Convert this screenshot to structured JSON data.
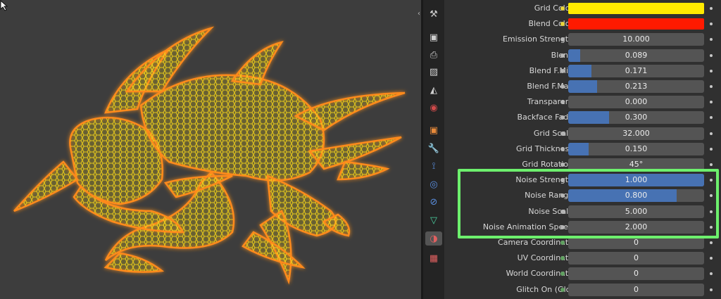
{
  "colors": {
    "grid_color": "#ffea00",
    "blend_color": "#ff1a00",
    "accent_fill": "#4772b3",
    "highlight": "#6df06d"
  },
  "properties": [
    {
      "label": "Grid Color",
      "type": "color",
      "color": "#ffea00",
      "dot": "yellow"
    },
    {
      "label": "Blend Color",
      "type": "color",
      "color": "#ff1a00",
      "dot": "yellow"
    },
    {
      "label": "Emission Strength",
      "type": "value",
      "value": "10.000",
      "fill": 0,
      "dot": "grey"
    },
    {
      "label": "Blend",
      "type": "value",
      "value": "0.089",
      "fill": 0.089,
      "dot": "grey"
    },
    {
      "label": "Blend F.Min",
      "type": "value",
      "value": "0.171",
      "fill": 0.171,
      "dot": "grey"
    },
    {
      "label": "Blend F.Max",
      "type": "value",
      "value": "0.213",
      "fill": 0.213,
      "dot": "grey"
    },
    {
      "label": "Transparent",
      "type": "value",
      "value": "0.000",
      "fill": 0,
      "dot": "grey"
    },
    {
      "label": "Backface Fade",
      "type": "value",
      "value": "0.300",
      "fill": 0.3,
      "dot": "grey"
    },
    {
      "label": "Grid Scale",
      "type": "value",
      "value": "32.000",
      "fill": 0,
      "dot": "grey"
    },
    {
      "label": "Grid Thickness",
      "type": "value",
      "value": "0.150",
      "fill": 0.15,
      "dot": "grey"
    },
    {
      "label": "Grid Rotation",
      "type": "value",
      "value": "45°",
      "fill": 0,
      "dot": "grey"
    },
    {
      "label": "Noise Strength",
      "type": "value",
      "value": "1.000",
      "fill": 1.0,
      "dot": "grey"
    },
    {
      "label": "Noise Range",
      "type": "value",
      "value": "0.800",
      "fill": 0.8,
      "dot": "grey"
    },
    {
      "label": "Noise Scale",
      "type": "value",
      "value": "5.000",
      "fill": 0,
      "dot": "grey"
    },
    {
      "label": "Noise Animation Speed",
      "type": "value",
      "value": "2.000",
      "fill": 0,
      "dot": "grey"
    },
    {
      "label": "Camera Coordinate",
      "type": "value",
      "value": "0",
      "fill": 0,
      "dot": "green"
    },
    {
      "label": "UV Coordinate",
      "type": "value",
      "value": "0",
      "fill": 0,
      "dot": "green"
    },
    {
      "label": "World Coordinate",
      "type": "value",
      "value": "0",
      "fill": 0,
      "dot": "green"
    },
    {
      "label": "Glitch On (Glc)",
      "type": "value",
      "value": "0",
      "fill": 0,
      "dot": "green"
    }
  ],
  "tabs": [
    {
      "name": "tool-icon",
      "glyph": "⚒",
      "color": "#cfcfcf"
    },
    {
      "name": "render-icon",
      "glyph": "▣",
      "color": "#cfcfcf"
    },
    {
      "name": "output-icon",
      "glyph": "⎙",
      "color": "#cfcfcf"
    },
    {
      "name": "view-layer-icon",
      "glyph": "▨",
      "color": "#cfcfcf"
    },
    {
      "name": "scene-icon",
      "glyph": "◭",
      "color": "#cfcfcf"
    },
    {
      "name": "world-icon",
      "glyph": "◉",
      "color": "#d04a4a"
    },
    {
      "name": "object-icon",
      "glyph": "▣",
      "color": "#e88a3a"
    },
    {
      "name": "modifier-icon",
      "glyph": "🔧",
      "color": "#5a8fe0"
    },
    {
      "name": "particles-icon",
      "glyph": "⟟",
      "color": "#5a8fe0"
    },
    {
      "name": "physics-icon",
      "glyph": "◎",
      "color": "#5a8fe0"
    },
    {
      "name": "constraints-icon",
      "glyph": "⊘",
      "color": "#5a8fe0"
    },
    {
      "name": "data-icon",
      "glyph": "▽",
      "color": "#4ad0a0"
    },
    {
      "name": "material-icon",
      "glyph": "◑",
      "color": "#e06060"
    },
    {
      "name": "texture-icon",
      "glyph": "▦",
      "color": "#e06060"
    }
  ]
}
